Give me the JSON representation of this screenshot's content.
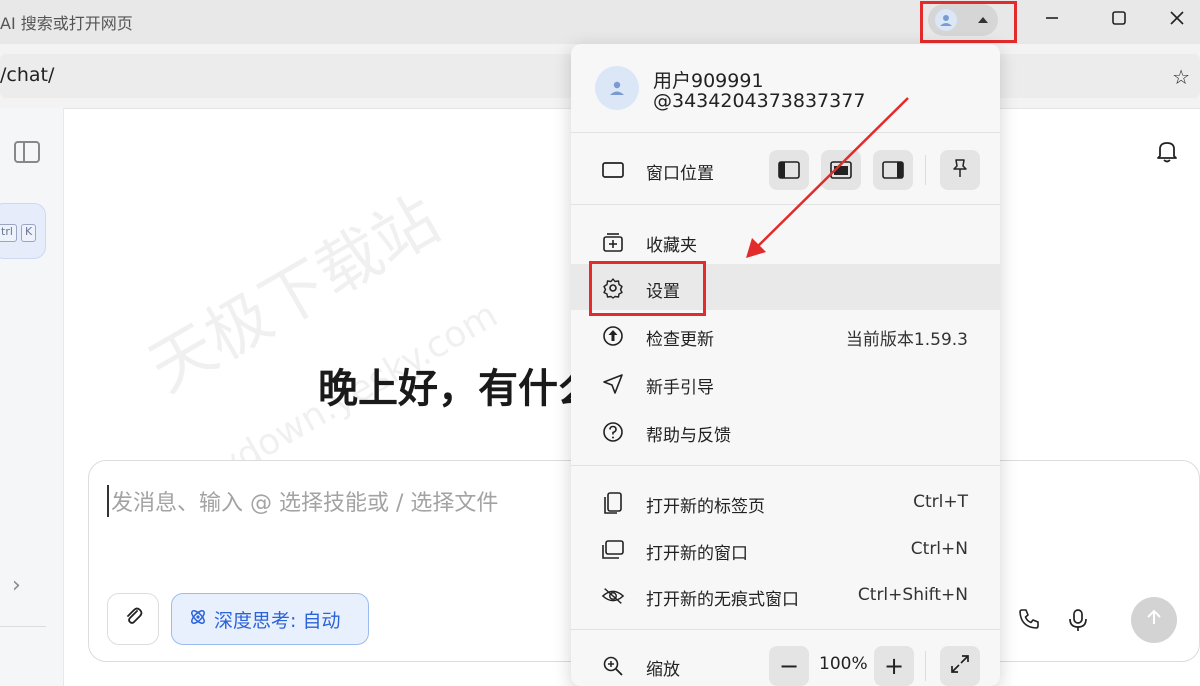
{
  "titlebar": {
    "tab_title": "AI 搜索或打开网页"
  },
  "addressbar": {
    "url": "/chat/"
  },
  "sidebar": {
    "kbd_ctrl": "trl",
    "kbd_k": "K"
  },
  "main": {
    "greeting": "晚上好，有什么"
  },
  "composer": {
    "placeholder": "发消息、输入 @ 选择技能或 / 选择文件",
    "think_label": "深度思考: 自动"
  },
  "watermark": {
    "text": "天极下载站",
    "url": "mydown.yesky.com"
  },
  "menu": {
    "account": {
      "name": "用户909991",
      "id": "@3434204373837377"
    },
    "window_position_label": "窗口位置",
    "items": [
      {
        "label": "收藏夹",
        "right": ""
      },
      {
        "label": "设置",
        "right": ""
      },
      {
        "label": "检查更新",
        "right": "当前版本1.59.3"
      },
      {
        "label": "新手引导",
        "right": ""
      },
      {
        "label": "帮助与反馈",
        "right": ""
      }
    ],
    "open_items": [
      {
        "label": "打开新的标签页",
        "shortcut": "Ctrl+T"
      },
      {
        "label": "打开新的窗口",
        "shortcut": "Ctrl+N"
      },
      {
        "label": "打开新的无痕式窗口",
        "shortcut": "Ctrl+Shift+N"
      }
    ],
    "zoom": {
      "label": "缩放",
      "value": "100%",
      "minus": "−",
      "plus": "+"
    }
  },
  "colors": {
    "highlight": "#e32b2b",
    "accent": "#2b63d9"
  }
}
